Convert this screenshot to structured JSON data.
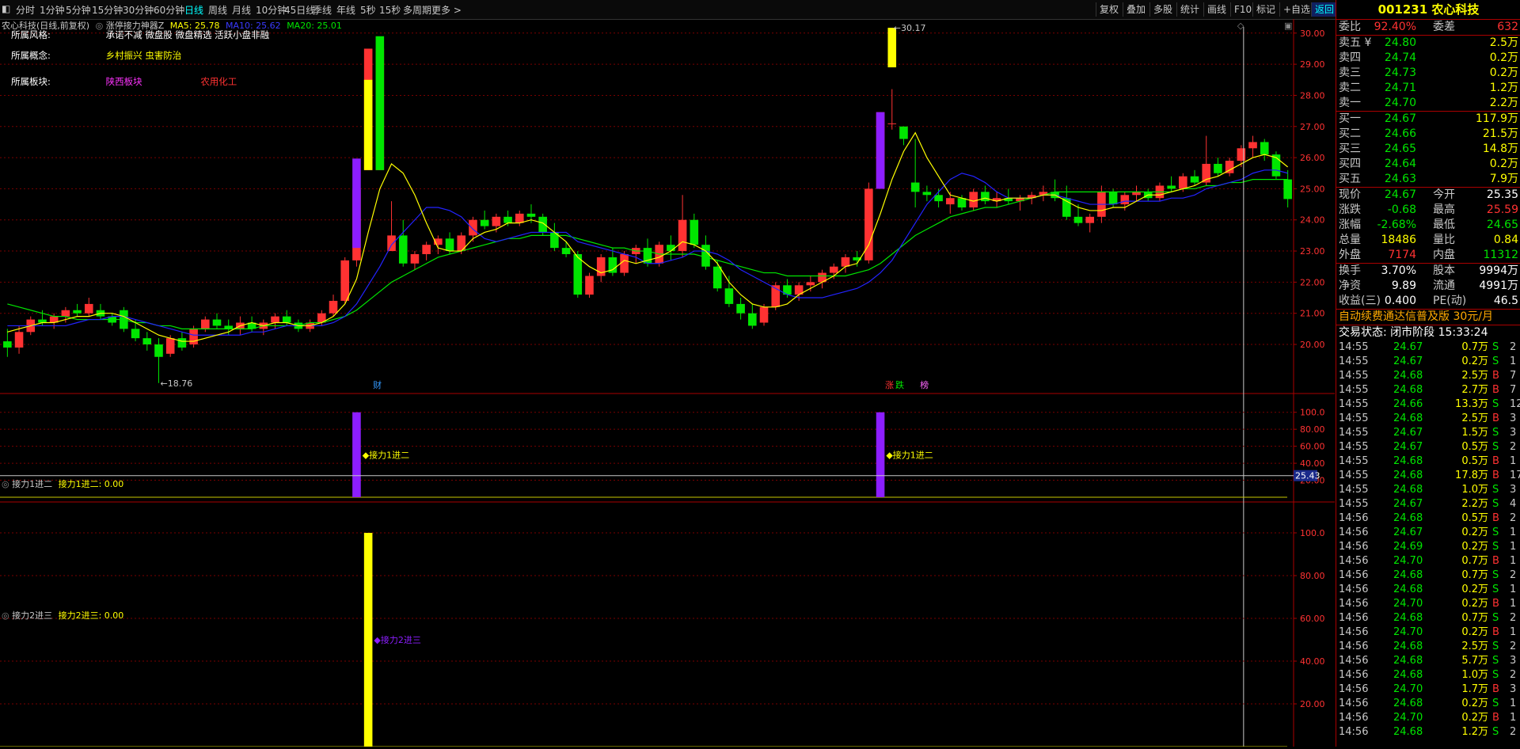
{
  "toolbar": {
    "periods": [
      "分时",
      "1分钟",
      "5分钟",
      "15分钟",
      "30分钟",
      "60分钟",
      "日线",
      "周线",
      "月线",
      "10分钟",
      "45日线",
      "季线",
      "年线",
      "5秒",
      "15秒",
      "多周期",
      "更多 >"
    ],
    "active_period": "日线",
    "right_buttons": [
      "复权",
      "叠加",
      "多股",
      "统计",
      "画线",
      "F10",
      "标记",
      "+自选",
      "返回"
    ]
  },
  "main_chart": {
    "stock_title": "农心科技(日线,前复权)",
    "indicator_name": "涨停接力神器Z",
    "ma5_label": "MA5: 25.78",
    "ma10_label": "MA10: 25.62",
    "ma20_label": "MA20: 25.01",
    "info": [
      {
        "label": "所属风格:",
        "values": [
          "承诺不减",
          "微盘股",
          "微盘精选",
          "活跃小盘非融"
        ]
      },
      {
        "label": "所属概念:",
        "values": [
          "乡村振兴",
          "虫害防治"
        ]
      },
      {
        "label": "所属板块:",
        "values": [
          "陕西板块",
          "农用化工"
        ]
      }
    ],
    "y_ticks": [
      "30.00",
      "29.00",
      "28.00",
      "27.00",
      "26.00",
      "25.00",
      "24.00",
      "23.00",
      "22.00",
      "21.00",
      "20.00"
    ],
    "low_mark": "18.76",
    "high_mark": "30.17",
    "markers": [
      "财",
      "涨",
      "跌",
      "榜"
    ]
  },
  "sub1": {
    "title": "接力1进二",
    "value_label": "接力1进二: 0.00",
    "y_ticks": [
      "100.0",
      "80.00",
      "60.00",
      "40.00",
      "20.00"
    ],
    "bar_label": "接力1进二",
    "crosshair_value": "25.43"
  },
  "sub2": {
    "title": "接力2进三",
    "value_label": "接力2进三: 0.00",
    "y_ticks": [
      "100.0",
      "80.00",
      "60.00",
      "40.00",
      "20.00"
    ],
    "bar_label": "接力2进三"
  },
  "chart_data": {
    "type": "candlestick",
    "ylim": [
      18.5,
      30.3
    ],
    "candles": [
      [
        20.1,
        20.5,
        19.6,
        19.9
      ],
      [
        19.9,
        20.6,
        19.7,
        20.4
      ],
      [
        20.4,
        20.9,
        20.3,
        20.8
      ],
      [
        20.8,
        21.1,
        20.6,
        20.7
      ],
      [
        20.7,
        21.0,
        20.5,
        20.9
      ],
      [
        20.9,
        21.2,
        20.7,
        21.1
      ],
      [
        21.1,
        21.3,
        20.9,
        21.0
      ],
      [
        21.0,
        21.5,
        20.9,
        21.3
      ],
      [
        21.1,
        21.3,
        20.8,
        20.9
      ],
      [
        20.9,
        21.0,
        20.6,
        20.7
      ],
      [
        21.1,
        21.2,
        20.4,
        20.5
      ],
      [
        20.5,
        20.8,
        20.1,
        20.2
      ],
      [
        20.2,
        20.4,
        19.8,
        20.0
      ],
      [
        20.0,
        20.2,
        19.5,
        19.6
      ],
      [
        19.7,
        20.3,
        19.6,
        20.2
      ],
      [
        20.2,
        20.4,
        19.8,
        19.9
      ],
      [
        20.0,
        20.6,
        19.9,
        20.5
      ],
      [
        20.5,
        20.9,
        20.4,
        20.8
      ],
      [
        20.8,
        21.0,
        20.5,
        20.6
      ],
      [
        20.6,
        20.8,
        20.3,
        20.5
      ],
      [
        20.5,
        20.9,
        20.3,
        20.7
      ],
      [
        20.7,
        20.9,
        20.4,
        20.5
      ],
      [
        20.5,
        20.8,
        20.3,
        20.7
      ],
      [
        20.7,
        21.0,
        20.5,
        20.9
      ],
      [
        20.9,
        21.1,
        20.6,
        20.7
      ],
      [
        20.7,
        20.8,
        20.4,
        20.5
      ],
      [
        20.5,
        20.8,
        20.4,
        20.7
      ],
      [
        20.7,
        21.1,
        20.6,
        21.0
      ],
      [
        21.0,
        21.6,
        20.9,
        21.4
      ],
      [
        21.4,
        22.8,
        21.3,
        22.7
      ],
      [
        22.7,
        25.0,
        22.5,
        24.97
      ],
      [
        25.6,
        29.5,
        25.6,
        29.5
      ],
      [
        25.6,
        29.5,
        25.6,
        29.5
      ],
      [
        23.0,
        24.6,
        23.0,
        23.5
      ],
      [
        23.5,
        24.0,
        22.5,
        22.6
      ],
      [
        22.6,
        23.0,
        22.4,
        22.9
      ],
      [
        22.9,
        23.3,
        22.7,
        23.2
      ],
      [
        23.2,
        23.5,
        22.9,
        23.4
      ],
      [
        23.4,
        23.6,
        22.9,
        23.0
      ],
      [
        23.0,
        23.6,
        22.9,
        23.5
      ],
      [
        23.5,
        24.1,
        23.3,
        24.0
      ],
      [
        24.0,
        24.3,
        23.7,
        23.8
      ],
      [
        23.8,
        24.2,
        23.6,
        24.1
      ],
      [
        24.1,
        24.3,
        23.8,
        23.9
      ],
      [
        23.9,
        24.3,
        23.8,
        24.2
      ],
      [
        24.2,
        24.5,
        23.9,
        24.1
      ],
      [
        24.1,
        24.2,
        23.5,
        23.6
      ],
      [
        23.6,
        23.9,
        23.0,
        23.1
      ],
      [
        23.1,
        23.3,
        22.8,
        22.9
      ],
      [
        22.9,
        23.0,
        21.5,
        21.6
      ],
      [
        21.6,
        22.3,
        21.5,
        22.2
      ],
      [
        22.2,
        22.9,
        22.0,
        22.8
      ],
      [
        22.8,
        23.1,
        22.2,
        22.3
      ],
      [
        22.3,
        23.0,
        22.2,
        22.9
      ],
      [
        22.9,
        23.2,
        22.6,
        23.1
      ],
      [
        23.1,
        23.4,
        22.5,
        22.6
      ],
      [
        22.6,
        23.3,
        22.5,
        23.2
      ],
      [
        23.2,
        23.5,
        22.7,
        23.0
      ],
      [
        23.0,
        24.8,
        22.8,
        24.0
      ],
      [
        24.0,
        24.2,
        23.1,
        23.2
      ],
      [
        23.2,
        23.5,
        22.4,
        22.5
      ],
      [
        22.5,
        22.7,
        21.7,
        21.8
      ],
      [
        21.8,
        22.2,
        21.2,
        21.3
      ],
      [
        21.3,
        21.5,
        20.8,
        21.0
      ],
      [
        21.0,
        21.3,
        20.5,
        20.6
      ],
      [
        20.7,
        21.3,
        20.6,
        21.2
      ],
      [
        21.2,
        22.0,
        21.1,
        21.9
      ],
      [
        21.9,
        22.1,
        21.5,
        21.6
      ],
      [
        21.6,
        22.0,
        21.4,
        21.9
      ],
      [
        21.9,
        22.2,
        21.7,
        22.0
      ],
      [
        22.0,
        22.4,
        21.8,
        22.3
      ],
      [
        22.3,
        22.6,
        22.1,
        22.5
      ],
      [
        22.5,
        22.9,
        22.3,
        22.8
      ],
      [
        22.8,
        23.0,
        22.5,
        22.7
      ],
      [
        22.7,
        25.2,
        22.6,
        25.0
      ],
      [
        25.0,
        27.0,
        25.0,
        27.46
      ],
      [
        27.1,
        28.2,
        26.9,
        27.1
      ],
      [
        27.0,
        27.0,
        26.4,
        26.6
      ],
      [
        25.2,
        26.6,
        24.4,
        24.9
      ],
      [
        24.9,
        25.1,
        24.6,
        24.8
      ],
      [
        24.8,
        25.0,
        24.4,
        24.6
      ],
      [
        24.5,
        24.9,
        24.2,
        24.7
      ],
      [
        24.7,
        24.8,
        24.3,
        24.4
      ],
      [
        24.4,
        25.0,
        24.3,
        24.9
      ],
      [
        24.9,
        25.1,
        24.5,
        24.6
      ],
      [
        24.6,
        24.9,
        24.4,
        24.7
      ],
      [
        24.7,
        25.0,
        24.5,
        24.6
      ],
      [
        24.6,
        24.8,
        24.3,
        24.7
      ],
      [
        24.7,
        24.9,
        24.5,
        24.8
      ],
      [
        24.8,
        25.1,
        24.6,
        24.9
      ],
      [
        24.9,
        25.3,
        24.6,
        24.7
      ],
      [
        24.7,
        25.1,
        24.0,
        24.1
      ],
      [
        24.1,
        24.5,
        23.8,
        23.9
      ],
      [
        23.9,
        24.2,
        23.6,
        24.1
      ],
      [
        24.1,
        25.1,
        23.9,
        24.9
      ],
      [
        24.9,
        25.0,
        24.4,
        24.5
      ],
      [
        24.5,
        24.9,
        24.3,
        24.8
      ],
      [
        24.8,
        25.1,
        24.6,
        24.9
      ],
      [
        24.9,
        25.0,
        24.6,
        24.7
      ],
      [
        24.7,
        25.2,
        24.6,
        25.1
      ],
      [
        25.1,
        25.4,
        24.9,
        25.0
      ],
      [
        25.0,
        25.5,
        24.9,
        25.4
      ],
      [
        25.4,
        25.6,
        25.1,
        25.2
      ],
      [
        25.2,
        26.7,
        25.1,
        25.8
      ],
      [
        25.8,
        26.0,
        25.4,
        25.5
      ],
      [
        25.5,
        26.0,
        25.4,
        25.9
      ],
      [
        25.9,
        26.4,
        25.7,
        26.3
      ],
      [
        26.3,
        26.7,
        26.0,
        26.5
      ],
      [
        26.5,
        26.6,
        25.9,
        26.1
      ],
      [
        26.1,
        26.2,
        25.3,
        25.4
      ],
      [
        25.3,
        25.6,
        24.4,
        24.67
      ]
    ],
    "ma5": [
      20.4,
      20.5,
      20.6,
      20.7,
      20.7,
      20.8,
      20.9,
      20.9,
      21.0,
      21.0,
      20.9,
      20.7,
      20.5,
      20.3,
      20.2,
      20.1,
      20.1,
      20.2,
      20.3,
      20.4,
      20.6,
      20.7,
      20.6,
      20.7,
      20.7,
      20.6,
      20.6,
      20.7,
      20.9,
      21.3,
      22.1,
      23.6,
      25.0,
      25.8,
      25.5,
      24.8,
      23.9,
      23.1,
      23.0,
      23.0,
      23.4,
      23.6,
      23.7,
      23.9,
      23.9,
      24.0,
      23.9,
      23.6,
      23.3,
      22.8,
      22.5,
      22.3,
      22.4,
      22.7,
      22.6,
      22.7,
      22.8,
      23.0,
      23.3,
      23.2,
      23.0,
      22.6,
      22.0,
      21.6,
      21.3,
      21.2,
      21.2,
      21.3,
      21.6,
      21.8,
      22.0,
      22.2,
      22.5,
      22.6,
      23.2,
      24.2,
      25.3,
      26.2,
      26.8,
      26.0,
      25.4,
      24.8,
      24.7,
      24.6,
      24.7,
      24.6,
      24.7,
      24.7,
      24.7,
      24.8,
      24.8,
      24.6,
      24.4,
      24.3,
      24.3,
      24.4,
      24.4,
      24.6,
      24.8,
      24.8,
      24.9,
      25.0,
      25.1,
      25.3,
      25.4,
      25.6,
      25.8,
      26.0,
      26.1,
      26.0,
      25.7
    ],
    "ma10": [
      20.6,
      20.6,
      20.6,
      20.6,
      20.6,
      20.6,
      20.7,
      20.8,
      20.8,
      20.9,
      20.9,
      20.8,
      20.7,
      20.6,
      20.5,
      20.4,
      20.3,
      20.3,
      20.3,
      20.3,
      20.3,
      20.4,
      20.4,
      20.5,
      20.6,
      20.6,
      20.6,
      20.6,
      20.7,
      20.9,
      21.3,
      21.9,
      22.5,
      23.2,
      23.6,
      24.0,
      24.4,
      24.4,
      24.3,
      24.1,
      23.7,
      23.4,
      23.3,
      23.4,
      23.5,
      23.6,
      23.6,
      23.6,
      23.6,
      23.3,
      23.2,
      23.1,
      23.0,
      22.9,
      22.8,
      22.6,
      22.6,
      22.7,
      22.8,
      23.0,
      23.0,
      22.9,
      22.7,
      22.4,
      22.2,
      22.0,
      21.8,
      21.6,
      21.5,
      21.5,
      21.5,
      21.6,
      21.7,
      21.8,
      22.0,
      22.3,
      22.7,
      23.3,
      23.9,
      24.5,
      24.9,
      25.3,
      25.5,
      25.4,
      25.2,
      24.9,
      24.7,
      24.7,
      24.7,
      24.8,
      24.8,
      24.7,
      24.6,
      24.5,
      24.5,
      24.5,
      24.6,
      24.6,
      24.6,
      24.6,
      24.7,
      24.7,
      24.8,
      25.0,
      25.1,
      25.2,
      25.3,
      25.5,
      25.6,
      25.6,
      25.5
    ],
    "ma20": [
      21.3,
      21.2,
      21.1,
      21.0,
      20.9,
      20.9,
      20.8,
      20.8,
      20.8,
      20.8,
      20.8,
      20.7,
      20.7,
      20.6,
      20.6,
      20.5,
      20.5,
      20.5,
      20.5,
      20.5,
      20.5,
      20.5,
      20.6,
      20.6,
      20.6,
      20.6,
      20.7,
      20.7,
      20.8,
      20.9,
      21.1,
      21.4,
      21.7,
      22.0,
      22.2,
      22.4,
      22.6,
      22.8,
      22.9,
      23.0,
      23.1,
      23.2,
      23.3,
      23.4,
      23.4,
      23.5,
      23.5,
      23.5,
      23.5,
      23.4,
      23.3,
      23.2,
      23.1,
      23.1,
      23.0,
      23.0,
      22.9,
      22.9,
      22.9,
      22.9,
      22.8,
      22.7,
      22.6,
      22.5,
      22.4,
      22.3,
      22.3,
      22.2,
      22.2,
      22.2,
      22.2,
      22.2,
      22.2,
      22.3,
      22.4,
      22.6,
      22.9,
      23.2,
      23.5,
      23.7,
      23.9,
      24.1,
      24.2,
      24.3,
      24.4,
      24.4,
      24.5,
      24.6,
      24.7,
      24.8,
      24.9,
      24.9,
      24.9,
      24.9,
      24.9,
      24.9,
      24.9,
      24.9,
      24.9,
      24.9,
      24.9,
      25.0,
      25.0,
      25.1,
      25.1,
      25.2,
      25.2,
      25.3,
      25.3,
      25.3,
      25.3
    ],
    "signal1_indices": [
      30,
      75
    ],
    "signal2_indices": [
      31
    ],
    "sub_ylim": [
      0,
      110
    ]
  },
  "quote": {
    "header": "001231 农心科技",
    "weibi_label": "委比",
    "weibi": "92.40%",
    "weicha_label": "委差",
    "weicha": "632",
    "asks": [
      {
        "label": "卖五 ¥",
        "price": "24.80",
        "vol": "2.5万"
      },
      {
        "label": "卖四",
        "price": "24.74",
        "vol": "0.2万"
      },
      {
        "label": "卖三",
        "price": "24.73",
        "vol": "0.2万"
      },
      {
        "label": "卖二",
        "price": "24.71",
        "vol": "1.2万"
      },
      {
        "label": "卖一",
        "price": "24.70",
        "vol": "2.2万"
      }
    ],
    "bids": [
      {
        "label": "买一",
        "price": "24.67",
        "vol": "117.9万"
      },
      {
        "label": "买二",
        "price": "24.66",
        "vol": "21.5万"
      },
      {
        "label": "买三",
        "price": "24.65",
        "vol": "14.8万"
      },
      {
        "label": "买四",
        "price": "24.64",
        "vol": "0.2万"
      },
      {
        "label": "买五",
        "price": "24.63",
        "vol": "7.9万"
      }
    ],
    "stats": [
      {
        "l1": "现价",
        "v1": "24.67",
        "l2": "今开",
        "v2": "25.35",
        "c1": "green",
        "c2": "white"
      },
      {
        "l1": "涨跌",
        "v1": "-0.68",
        "l2": "最高",
        "v2": "25.59",
        "c1": "green",
        "c2": "red"
      },
      {
        "l1": "涨幅",
        "v1": "-2.68%",
        "l2": "最低",
        "v2": "24.65",
        "c1": "green",
        "c2": "green"
      },
      {
        "l1": "总量",
        "v1": "18486",
        "l2": "量比",
        "v2": "0.84",
        "c1": "yellow",
        "c2": "yellow"
      },
      {
        "l1": "外盘",
        "v1": "7174",
        "l2": "内盘",
        "v2": "11312",
        "c1": "red",
        "c2": "green"
      }
    ],
    "stats2": [
      {
        "l1": "换手",
        "v1": "3.70%",
        "l2": "股本",
        "v2": "9994万"
      },
      {
        "l1": "净资",
        "v1": "9.89",
        "l2": "流通",
        "v2": "4991万"
      },
      {
        "l1": "收益(三)",
        "v1": "0.400",
        "l2": "PE(动)",
        "v2": "46.5"
      }
    ],
    "ad_text": "自动续费通达信普及版 30元/月",
    "trade_status": "交易状态: 闭市阶段 15:33:24",
    "ticks": [
      [
        "14:55",
        "24.67",
        "0.7万",
        "S",
        "2"
      ],
      [
        "14:55",
        "24.67",
        "0.2万",
        "S",
        "1"
      ],
      [
        "14:55",
        "24.68",
        "2.5万",
        "B",
        "7"
      ],
      [
        "14:55",
        "24.68",
        "2.7万",
        "B",
        "7"
      ],
      [
        "14:55",
        "24.66",
        "13.3万",
        "S",
        "12"
      ],
      [
        "14:55",
        "24.68",
        "2.5万",
        "B",
        "3"
      ],
      [
        "14:55",
        "24.67",
        "1.5万",
        "S",
        "3"
      ],
      [
        "14:55",
        "24.67",
        "0.5万",
        "S",
        "2"
      ],
      [
        "14:55",
        "24.68",
        "0.5万",
        "B",
        "1"
      ],
      [
        "14:55",
        "24.68",
        "17.8万",
        "B",
        "17"
      ],
      [
        "14:55",
        "24.68",
        "1.0万",
        "S",
        "3"
      ],
      [
        "14:55",
        "24.67",
        "2.2万",
        "S",
        "4"
      ],
      [
        "14:56",
        "24.68",
        "0.5万",
        "B",
        "2"
      ],
      [
        "14:56",
        "24.67",
        "0.2万",
        "S",
        "1"
      ],
      [
        "14:56",
        "24.69",
        "0.2万",
        "S",
        "1"
      ],
      [
        "14:56",
        "24.70",
        "0.7万",
        "B",
        "1"
      ],
      [
        "14:56",
        "24.68",
        "0.7万",
        "S",
        "2"
      ],
      [
        "14:56",
        "24.68",
        "0.2万",
        "S",
        "1"
      ],
      [
        "14:56",
        "24.70",
        "0.2万",
        "B",
        "1"
      ],
      [
        "14:56",
        "24.68",
        "0.7万",
        "S",
        "2"
      ],
      [
        "14:56",
        "24.70",
        "0.2万",
        "B",
        "1"
      ],
      [
        "14:56",
        "24.68",
        "2.5万",
        "S",
        "2"
      ],
      [
        "14:56",
        "24.68",
        "5.7万",
        "S",
        "3"
      ],
      [
        "14:56",
        "24.68",
        "1.0万",
        "S",
        "2"
      ],
      [
        "14:56",
        "24.70",
        "1.7万",
        "B",
        "3"
      ],
      [
        "14:56",
        "24.68",
        "0.2万",
        "S",
        "1"
      ],
      [
        "14:56",
        "24.70",
        "0.2万",
        "B",
        "1"
      ],
      [
        "14:56",
        "24.68",
        "1.2万",
        "S",
        "2"
      ]
    ]
  },
  "colors": {
    "up": "#ff3232",
    "down": "#00e600",
    "ma5": "#ffff00",
    "ma10": "#2323ff",
    "ma20": "#00e600",
    "signal1": "#8c1eff",
    "signal2": "#ffff00",
    "grid": "#7a0000"
  }
}
